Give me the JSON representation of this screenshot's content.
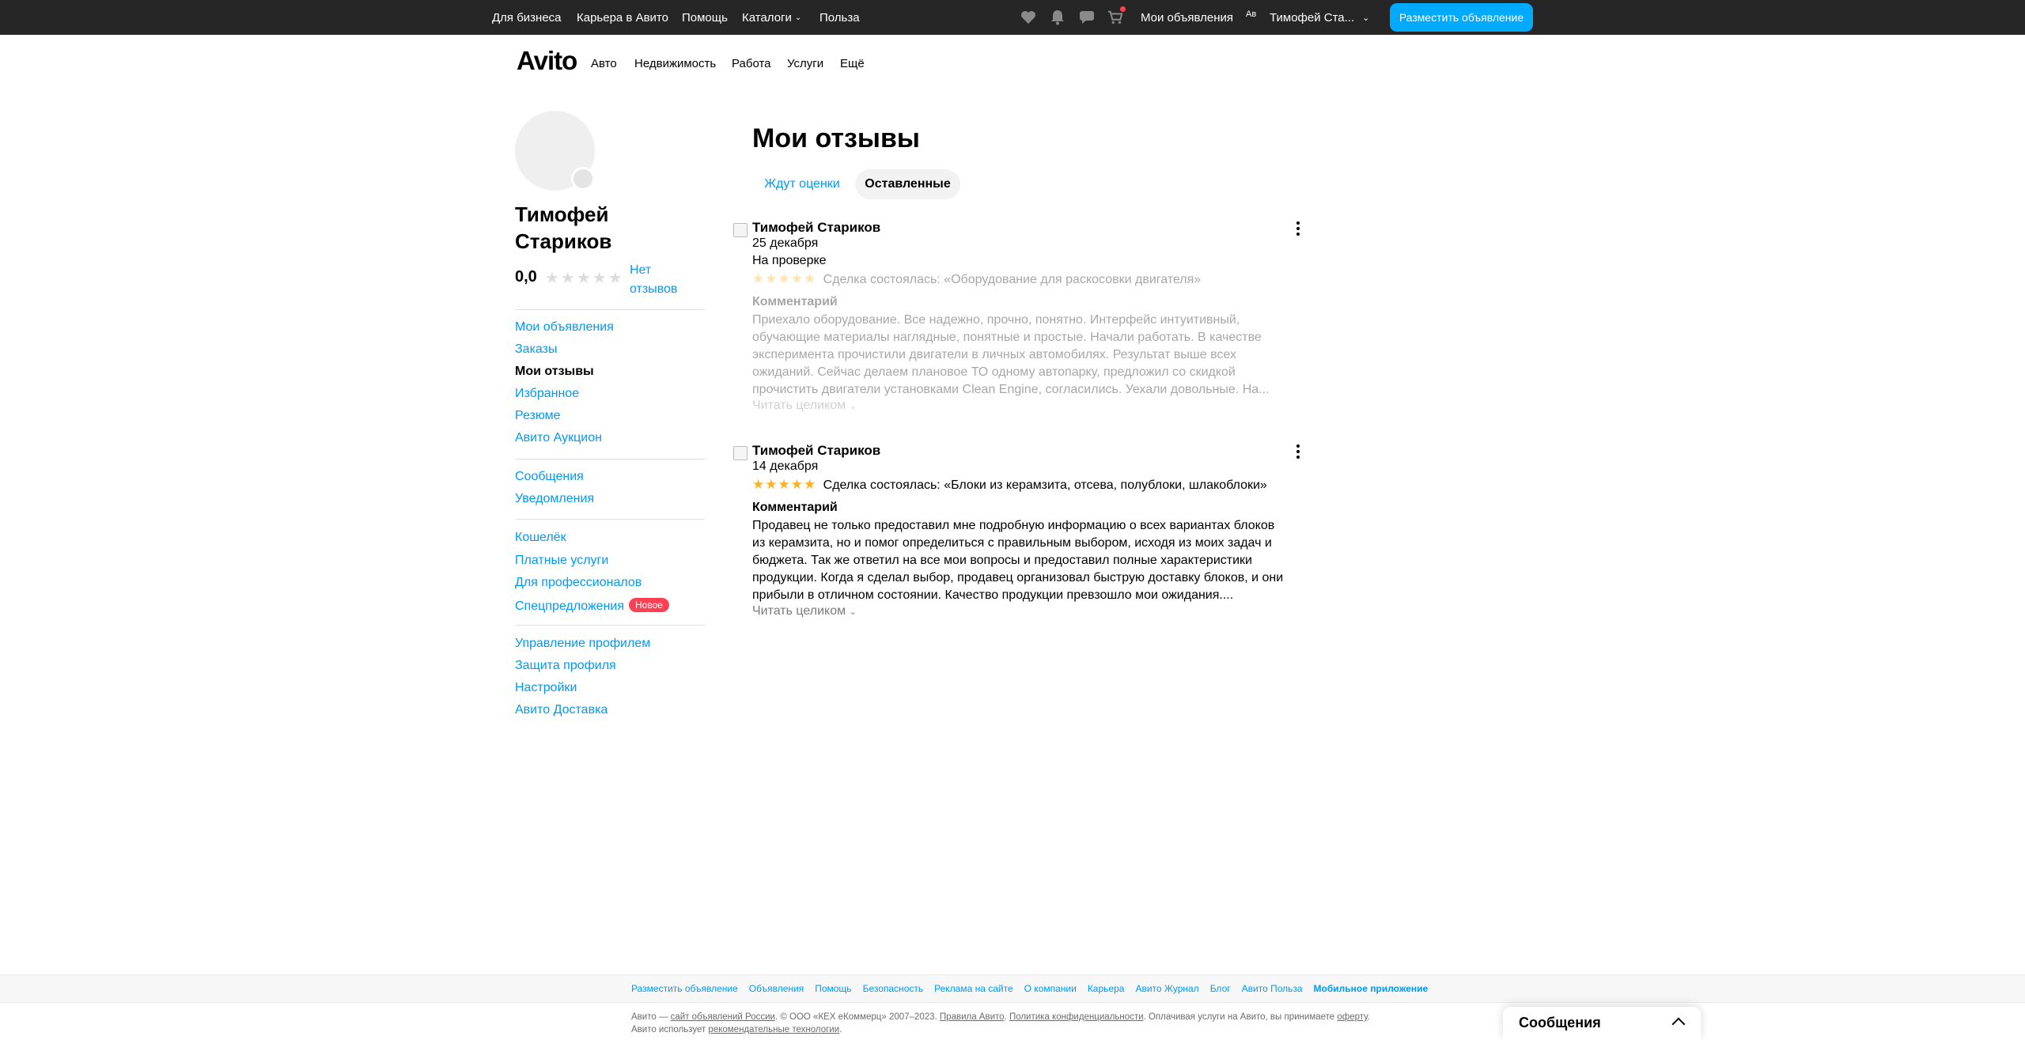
{
  "topbar": {
    "links": [
      "Для бизнеса",
      "Карьера в Авито",
      "Помощь",
      "Каталоги",
      "Польза"
    ],
    "my_ads": "Мои объявления",
    "user_name": "Тимофей Ста...",
    "avatar_alt": "Ав",
    "post_button": "Разместить объявление",
    "icons": [
      "heart-icon",
      "bell-icon",
      "chat-icon",
      "cart-icon"
    ]
  },
  "header": {
    "logo": "Avito",
    "nav": [
      "Авто",
      "Недвижимость",
      "Работа",
      "Услуги",
      "Ещё"
    ]
  },
  "profile": {
    "name": "Тимофей Стариков",
    "rating": "0,0",
    "stars_filled": 0,
    "no_reviews": "Нет отзывов"
  },
  "sidebar": {
    "group1": [
      "Мои объявления",
      "Заказы",
      "Мои отзывы",
      "Избранное",
      "Резюме",
      "Авито Аукцион"
    ],
    "active": "Мои отзывы",
    "group2": [
      "Сообщения",
      "Уведомления"
    ],
    "group3": [
      "Кошелёк",
      "Платные услуги",
      "Для профессионалов",
      "Спецпредложения"
    ],
    "new_badge": "Новое",
    "group4": [
      "Управление профилем",
      "Защита профиля",
      "Настройки",
      "Авито Доставка"
    ]
  },
  "main": {
    "title": "Мои отзывы",
    "tabs": [
      {
        "label": "Ждут оценки",
        "active": false
      },
      {
        "label": "Оставленные",
        "active": true
      }
    ]
  },
  "reviews": [
    {
      "author": "Тимофей Стариков",
      "date": "25 декабря",
      "status": "На проверке",
      "stars": 5,
      "deal": "Сделка состоялась: «Оборудование для раскосовки двигателя»",
      "comment_heading": "Комментарий",
      "comment": "Приехало оборудование. Все надежно, прочно, понятно. Интерфейс интуитивный, обучающие материалы наглядные, понятные и простые. Начали работать. В качестве эксперимента прочистили двигатели в личных автомобилях. Результат выше всех ожиданий. Сейчас делаем плановое ТО одному автопарку, предложил со скидкой прочистить двигатели установками Clean Engine, согласились. Уехали довольные. На...",
      "read_more": "Читать целиком"
    },
    {
      "author": "Тимофей Стариков",
      "date": "14 декабря",
      "stars": 5,
      "deal": "Сделка состоялась: «Блоки из керамзита, отсева, полублоки, шлакоблоки»",
      "comment_heading": "Комментарий",
      "comment": "Продавец не только предоставил мне подробную информацию о всех вариантах блоков из керамзита, но и помог определиться с правильным выбором, исходя из моих задач и бюджета. Так же ответил на все мои вопросы и предоставил полные характеристики продукции. Когда я сделал выбор, продавец организовал быструю доставку блоков, и они прибыли в отличном состоянии. Качество продукции превзошло мои ожидания....",
      "read_more": "Читать целиком"
    }
  ],
  "footer": {
    "links": [
      "Разместить объявление",
      "Объявления",
      "Помощь",
      "Безопасность",
      "Реклама на сайте",
      "О компании",
      "Карьера",
      "Авито Журнал",
      "Блог",
      "Авито Польза",
      "Мобильное приложение"
    ],
    "copy_1": "Авито — ",
    "copy_link1": "сайт объявлений России",
    "copy_2": ". © ООО «КЕХ еКоммерц» 2007–2023. ",
    "copy_link2": "Правила Авито",
    "copy_3": ". ",
    "copy_link3": "Политика конфиденциальности",
    "copy_4": ". Оплачивая услуги на Авито, вы принимаете ",
    "copy_link4": "оферту",
    "copy_5": ". Авито использует ",
    "copy_link5": "рекомендательные технологии",
    "copy_6": "."
  },
  "messages_panel": {
    "title": "Сообщения"
  }
}
